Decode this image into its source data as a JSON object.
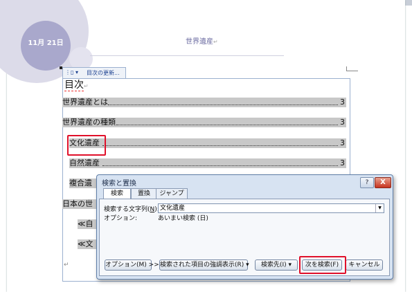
{
  "header": {
    "date": "11月 21日",
    "title": "世界遺産",
    "para_mark": "↵"
  },
  "toc": {
    "tab_label": "目次の更新...",
    "heading": "目次",
    "entries": [
      {
        "text": "世界遺産とは",
        "page": "3"
      },
      {
        "text": "世界遺産の種類",
        "page": "3"
      },
      {
        "text": "文化遺産",
        "page": "3"
      },
      {
        "text": "自然遺産",
        "page": "3"
      },
      {
        "text": "複合遺産",
        "page": ""
      },
      {
        "text": "日本の世界",
        "page": ""
      },
      {
        "text": "≪自然",
        "page": ""
      },
      {
        "text": "≪文化",
        "page": ""
      }
    ],
    "end_mark": "↵"
  },
  "dialog": {
    "title": "検索と置換",
    "help": "?",
    "close": "X",
    "tabs": [
      "検索",
      "置換",
      "ジャンプ"
    ],
    "search_label_pre": "検索する文字列(",
    "search_label_key": "N",
    "search_label_post": "):",
    "search_value": "文化遺産",
    "options_label": "オプション:",
    "options_value": "あいまい検索 (日)",
    "buttons": {
      "options": "オプション(M) >>",
      "highlight": "検索された項目の強調表示(R) ▾",
      "search_in": "検索先(I) ▾",
      "find_next": "次を検索(F)",
      "cancel": "キャンセル"
    }
  }
}
